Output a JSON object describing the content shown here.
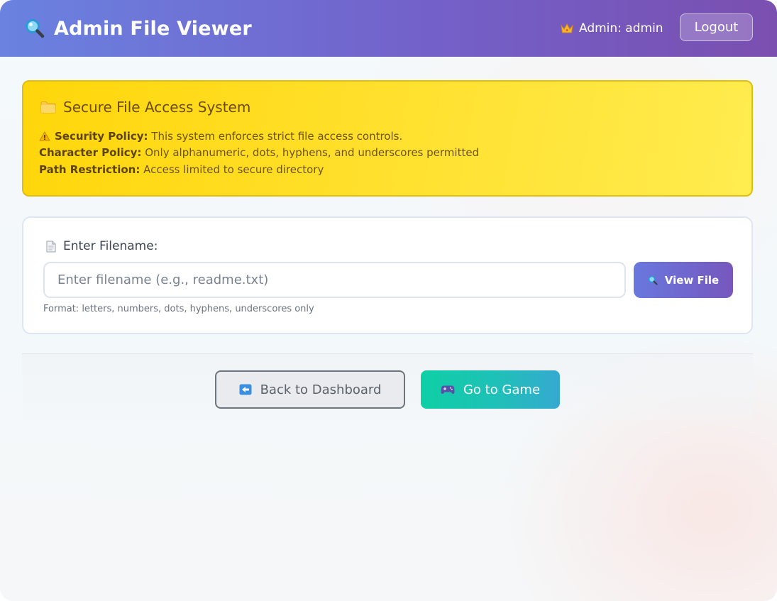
{
  "header": {
    "title": "Admin File Viewer",
    "title_icon": "magnifier-icon",
    "user_icon": "crown-icon",
    "user_label": "Admin: admin",
    "logout_label": "Logout"
  },
  "notice": {
    "icon": "folder-icon",
    "title": "Secure File Access System",
    "policies": [
      {
        "icon": "warning-icon",
        "label": "Security Policy:",
        "text": "This system enforces strict file access controls."
      },
      {
        "label": "Character Policy:",
        "text": "Only alphanumeric, dots, hyphens, and underscores permitted"
      },
      {
        "label": "Path Restriction:",
        "text": "Access limited to secure directory"
      }
    ]
  },
  "form": {
    "label_icon": "document-icon",
    "label": "Enter Filename:",
    "input_value": "",
    "input_placeholder": "Enter filename (e.g., readme.txt)",
    "submit_icon": "magnifier-icon",
    "submit_label": "View File",
    "hint": "Format: letters, numbers, dots, hyphens, underscores only"
  },
  "actions": {
    "back_icon": "back-arrow-icon",
    "back_label": "Back to Dashboard",
    "game_icon": "gamepad-icon",
    "game_label": "Go to Game"
  },
  "colors": {
    "header_gradient_start": "#6a82e0",
    "header_gradient_end": "#7a4fb0",
    "notice_background": "#ffd60a",
    "notice_border": "#e0be12",
    "primary_button": "#6978de",
    "game_button_start": "#0fcfa5",
    "game_button_end": "#36a9d1"
  }
}
